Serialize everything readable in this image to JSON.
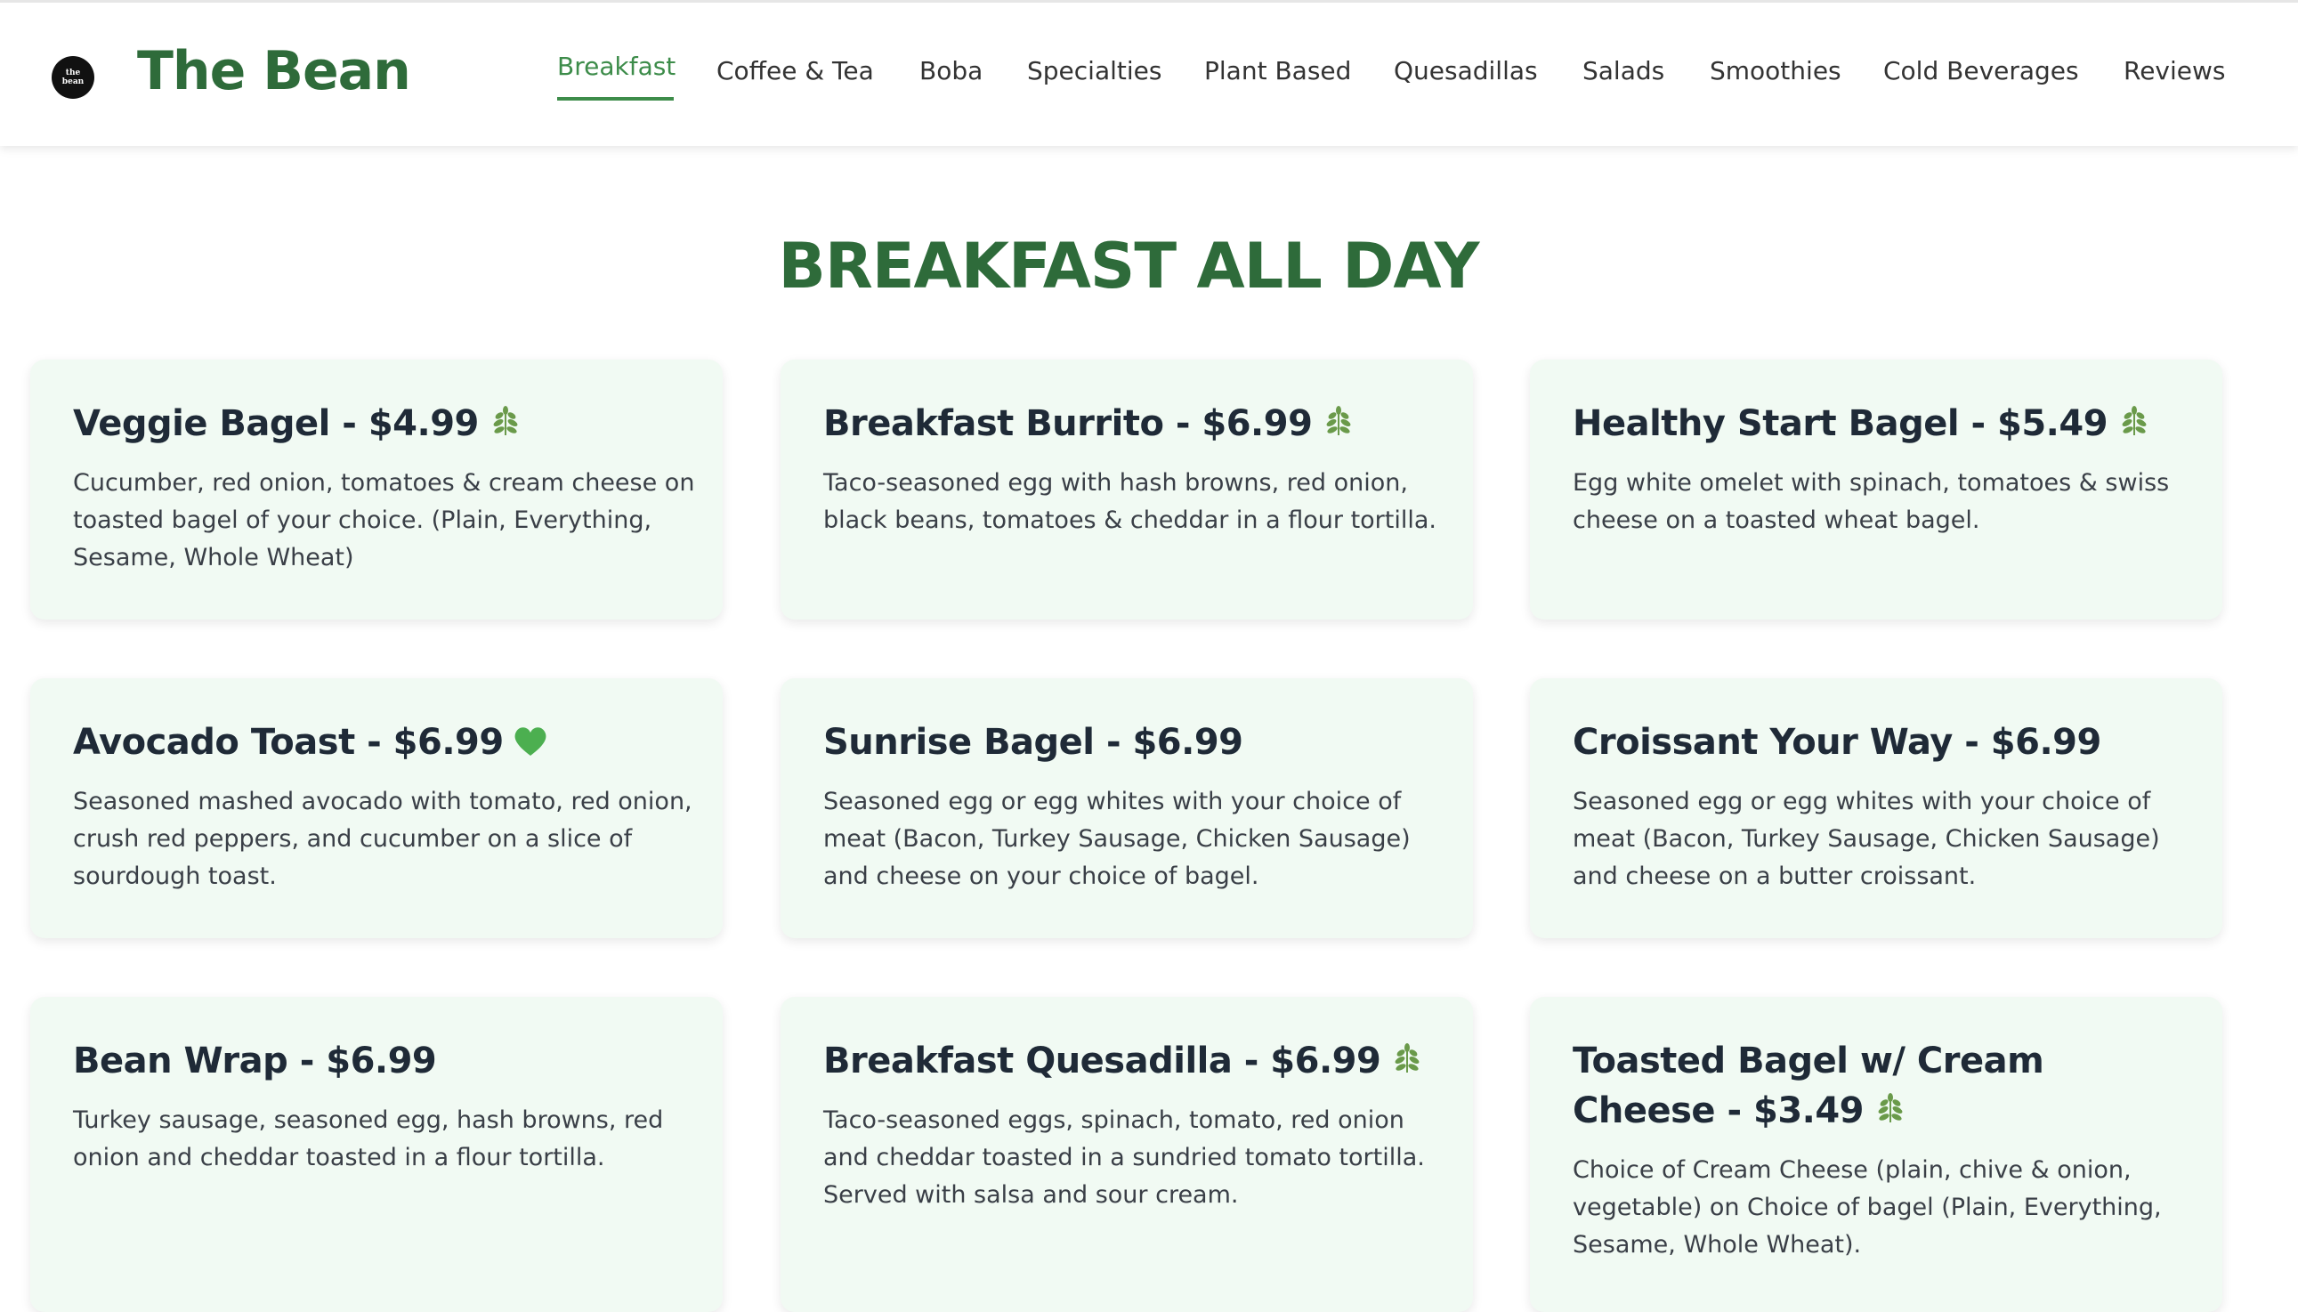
{
  "brand": {
    "name": "The Bean",
    "logo_text": "the bean"
  },
  "nav": {
    "items": [
      {
        "label": "Breakfast",
        "active": true
      },
      {
        "label": "Coffee & Tea",
        "active": false
      },
      {
        "label": "Boba",
        "active": false
      },
      {
        "label": "Specialties",
        "active": false
      },
      {
        "label": "Plant Based",
        "active": false
      },
      {
        "label": "Quesadillas",
        "active": false
      },
      {
        "label": "Salads",
        "active": false
      },
      {
        "label": "Smoothies",
        "active": false
      },
      {
        "label": "Cold Beverages",
        "active": false
      },
      {
        "label": "Reviews",
        "active": false
      }
    ]
  },
  "section": {
    "title": "BREAKFAST ALL DAY"
  },
  "menu": [
    {
      "title": "Veggie Bagel - $4.99",
      "icon": "leaf-icon",
      "description": "Cucumber, red onion, tomatoes & cream cheese on toasted bagel of your choice. (Plain, Everything, Sesame, Whole Wheat)"
    },
    {
      "title": "Breakfast Burrito - $6.99",
      "icon": "leaf-icon",
      "description": "Taco-seasoned egg with hash browns, red onion, black beans, tomatoes & cheddar in a flour tortilla."
    },
    {
      "title": "Healthy Start Bagel - $5.49",
      "icon": "leaf-icon",
      "description": "Egg white omelet with spinach, tomatoes & swiss cheese on a toasted wheat bagel."
    },
    {
      "title": "Avocado Toast - $6.99",
      "icon": "green-heart-icon",
      "description": "Seasoned mashed avocado with tomato, red onion, crush red peppers, and cucumber on a slice of sourdough toast."
    },
    {
      "title": "Sunrise Bagel - $6.99",
      "icon": "",
      "description": "Seasoned egg or egg whites with your choice of meat (Bacon, Turkey Sausage, Chicken Sausage) and cheese on your choice of bagel."
    },
    {
      "title": "Croissant Your Way - $6.99",
      "icon": "",
      "description": "Seasoned egg or egg whites with your choice of meat (Bacon, Turkey Sausage, Chicken Sausage) and cheese on a butter croissant."
    },
    {
      "title": "Bean Wrap - $6.99",
      "icon": "",
      "description": "Turkey sausage, seasoned egg, hash browns, red onion and cheddar toasted in a flour tortilla."
    },
    {
      "title": "Breakfast Quesadilla - $6.99",
      "icon": "leaf-icon",
      "description": "Taco-seasoned eggs, spinach, tomato, red onion and cheddar toasted in a sundried tomato tortilla. Served with salsa and sour cream."
    },
    {
      "title": "Toasted Bagel w/ Cream Cheese - $3.49",
      "icon": "leaf-icon",
      "description": "Choice of Cream Cheese (plain, chive & onion, vegetable) on Choice of bagel (Plain, Everything, Sesame, Whole Wheat)."
    }
  ],
  "colors": {
    "brand_green": "#2e6b3a",
    "active_nav": "#3d8c4a",
    "card_bg": "#f1faf3",
    "leaf": "#6a9a4a",
    "heart": "#4caf50"
  }
}
